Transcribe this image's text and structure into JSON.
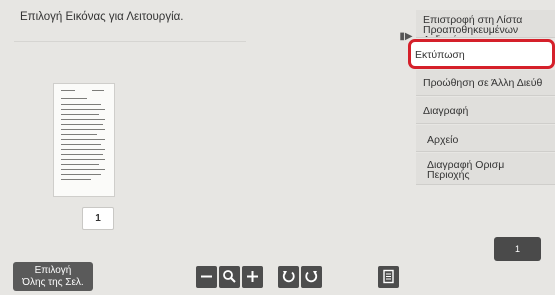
{
  "message": "Επιλογή Εικόνας για Λειτουργία.",
  "thumbnail": {
    "page_number": "1"
  },
  "menu": {
    "items": [
      "Επιστροφή στη Λίστα Προαποθηκευμένων Δεδομένων",
      "Εκτύπωση",
      "Προώθηση σε Άλλη Διεύθ",
      "Διαγραφή",
      "Αρχείο",
      "Διαγραφή Ορισμ Περιοχής"
    ],
    "selected_index": 1,
    "highlight_color": "#d5202a"
  },
  "counter": {
    "value": "1"
  },
  "select_all": {
    "line1": "Επιλογή",
    "line2": "Όλης της Σελ."
  },
  "toolbar": [
    "zoom-out-icon",
    "magnifier-icon",
    "zoom-in-icon",
    "rotate-left-icon",
    "rotate-right-icon",
    "list-view-icon"
  ]
}
